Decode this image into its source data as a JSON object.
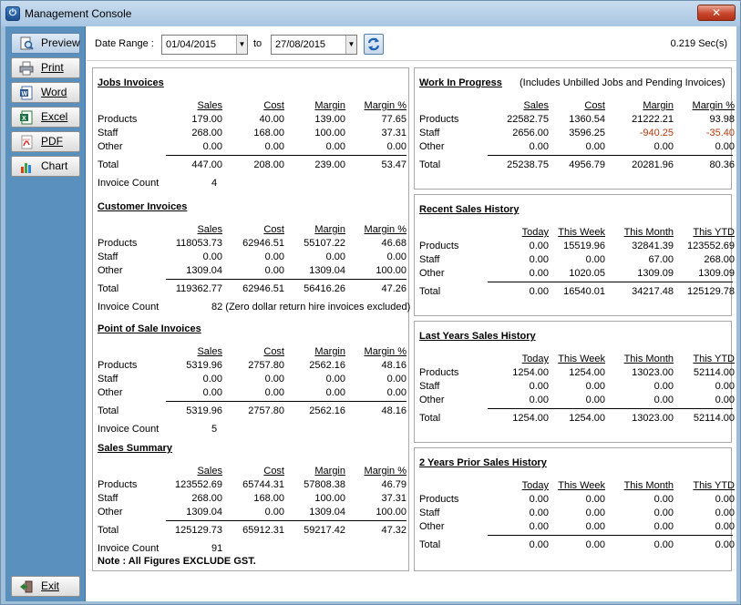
{
  "window": {
    "title": "Management Console",
    "close_glyph": "✕",
    "app_icon_glyph": "⏻"
  },
  "sidebar": {
    "buttons": [
      {
        "label": "Preview",
        "icon": "preview-icon"
      },
      {
        "label": "Print",
        "icon": "printer-icon"
      },
      {
        "label": "Word",
        "icon": "word-icon"
      },
      {
        "label": "Excel",
        "icon": "excel-icon"
      },
      {
        "label": "PDF",
        "icon": "pdf-icon"
      },
      {
        "label": "Chart",
        "icon": "chart-icon"
      }
    ],
    "exit_label": "Exit"
  },
  "toolbar": {
    "date_range_label": "Date Range :",
    "from_date": "01/04/2015",
    "to_label": "to",
    "to_date": "27/08/2015",
    "elapsed": "0.219 Sec(s)"
  },
  "jobs": {
    "title": "Jobs Invoices",
    "headers": [
      "Sales",
      "Cost",
      "Margin",
      "Margin %"
    ],
    "rows": [
      {
        "label": "Products",
        "values": [
          "179.00",
          "40.00",
          "139.00",
          "77.65"
        ]
      },
      {
        "label": "Staff",
        "values": [
          "268.00",
          "168.00",
          "100.00",
          "37.31"
        ]
      },
      {
        "label": "Other",
        "values": [
          "0.00",
          "0.00",
          "0.00",
          "0.00"
        ]
      }
    ],
    "total": {
      "label": "Total",
      "values": [
        "447.00",
        "208.00",
        "239.00",
        "53.47"
      ]
    },
    "count_label": "Invoice Count",
    "count_value": "4"
  },
  "customer": {
    "title": "Customer Invoices",
    "headers": [
      "Sales",
      "Cost",
      "Margin",
      "Margin %"
    ],
    "rows": [
      {
        "label": "Products",
        "values": [
          "118053.73",
          "62946.51",
          "55107.22",
          "46.68"
        ]
      },
      {
        "label": "Staff",
        "values": [
          "0.00",
          "0.00",
          "0.00",
          "0.00"
        ]
      },
      {
        "label": "Other",
        "values": [
          "1309.04",
          "0.00",
          "1309.04",
          "100.00"
        ]
      }
    ],
    "total": {
      "label": "Total",
      "values": [
        "119362.77",
        "62946.51",
        "56416.26",
        "47.26"
      ]
    },
    "count_label": "Invoice Count",
    "count_value": "82 (Zero dollar return hire invoices excluded)"
  },
  "pos": {
    "title": "Point of Sale Invoices",
    "headers": [
      "Sales",
      "Cost",
      "Margin",
      "Margin %"
    ],
    "rows": [
      {
        "label": "Products",
        "values": [
          "5319.96",
          "2757.80",
          "2562.16",
          "48.16"
        ]
      },
      {
        "label": "Staff",
        "values": [
          "0.00",
          "0.00",
          "0.00",
          "0.00"
        ]
      },
      {
        "label": "Other",
        "values": [
          "0.00",
          "0.00",
          "0.00",
          "0.00"
        ]
      }
    ],
    "total": {
      "label": "Total",
      "values": [
        "5319.96",
        "2757.80",
        "2562.16",
        "48.16"
      ]
    },
    "count_label": "Invoice Count",
    "count_value": "5"
  },
  "summary": {
    "title": "Sales Summary",
    "headers": [
      "Sales",
      "Cost",
      "Margin",
      "Margin %"
    ],
    "rows": [
      {
        "label": "Products",
        "values": [
          "123552.69",
          "65744.31",
          "57808.38",
          "46.79"
        ]
      },
      {
        "label": "Staff",
        "values": [
          "268.00",
          "168.00",
          "100.00",
          "37.31"
        ]
      },
      {
        "label": "Other",
        "values": [
          "1309.04",
          "0.00",
          "1309.04",
          "100.00"
        ]
      }
    ],
    "total": {
      "label": "Total",
      "values": [
        "125129.73",
        "65912.31",
        "59217.42",
        "47.32"
      ]
    },
    "count_label": "Invoice Count",
    "count_value": "91"
  },
  "wip": {
    "title": "Work In Progress",
    "subtitle": "(Includes Unbilled Jobs and Pending Invoices)",
    "headers": [
      "Sales",
      "Cost",
      "Margin",
      "Margin %"
    ],
    "rows": [
      {
        "label": "Products",
        "values": [
          "22582.75",
          "1360.54",
          "21222.21",
          "93.98"
        ]
      },
      {
        "label": "Staff",
        "values": [
          "2656.00",
          "3596.25",
          "-940.25",
          "-35.40"
        ]
      },
      {
        "label": "Other",
        "values": [
          "0.00",
          "0.00",
          "0.00",
          "0.00"
        ]
      }
    ],
    "total": {
      "label": "Total",
      "values": [
        "25238.75",
        "4956.79",
        "20281.96",
        "80.36"
      ]
    },
    "negative_color": "#b53a10"
  },
  "recent": {
    "title": "Recent Sales History",
    "headers": [
      "Today",
      "This Week",
      "This Month",
      "This YTD"
    ],
    "rows": [
      {
        "label": "Products",
        "values": [
          "0.00",
          "15519.96",
          "32841.39",
          "123552.69"
        ]
      },
      {
        "label": "Staff",
        "values": [
          "0.00",
          "0.00",
          "67.00",
          "268.00"
        ]
      },
      {
        "label": "Other",
        "values": [
          "0.00",
          "1020.05",
          "1309.09",
          "1309.09"
        ]
      }
    ],
    "total": {
      "label": "Total",
      "values": [
        "0.00",
        "16540.01",
        "34217.48",
        "125129.78"
      ]
    }
  },
  "lastyear": {
    "title": "Last Years Sales History",
    "headers": [
      "Today",
      "This Week",
      "This Month",
      "This YTD"
    ],
    "rows": [
      {
        "label": "Products",
        "values": [
          "1254.00",
          "1254.00",
          "13023.00",
          "52114.00"
        ]
      },
      {
        "label": "Staff",
        "values": [
          "0.00",
          "0.00",
          "0.00",
          "0.00"
        ]
      },
      {
        "label": "Other",
        "values": [
          "0.00",
          "0.00",
          "0.00",
          "0.00"
        ]
      }
    ],
    "total": {
      "label": "Total",
      "values": [
        "1254.00",
        "1254.00",
        "13023.00",
        "52114.00"
      ]
    }
  },
  "twoyears": {
    "title": "2 Years Prior Sales History",
    "headers": [
      "Today",
      "This Week",
      "This Month",
      "This YTD"
    ],
    "rows": [
      {
        "label": "Products",
        "values": [
          "0.00",
          "0.00",
          "0.00",
          "0.00"
        ]
      },
      {
        "label": "Staff",
        "values": [
          "0.00",
          "0.00",
          "0.00",
          "0.00"
        ]
      },
      {
        "label": "Other",
        "values": [
          "0.00",
          "0.00",
          "0.00",
          "0.00"
        ]
      }
    ],
    "total": {
      "label": "Total",
      "values": [
        "0.00",
        "0.00",
        "0.00",
        "0.00"
      ]
    }
  },
  "footer": {
    "note": "Note : All Figures EXCLUDE GST."
  }
}
